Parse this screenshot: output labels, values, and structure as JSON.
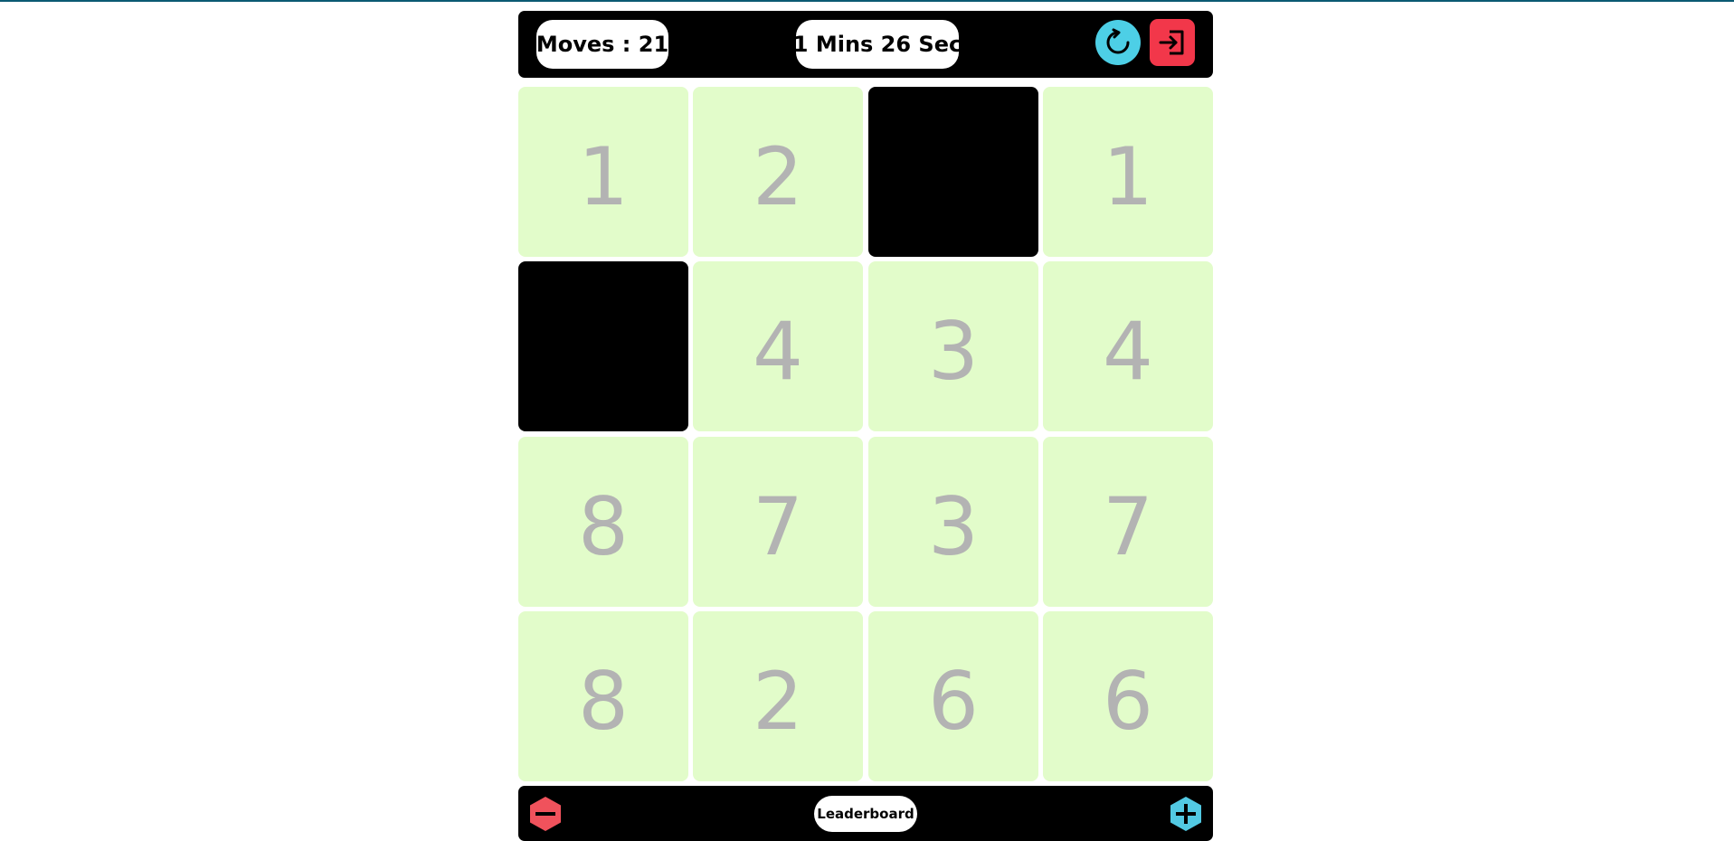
{
  "colors": {
    "top_line": "#0b5a73",
    "bar_bg": "#000000",
    "tile_bg": "#e2fcca",
    "tile_hidden": "#000000",
    "tile_text": "#b3b3b3",
    "restart": "#4dcfe6",
    "exit": "#f2374a",
    "minus": "#f0525c",
    "plus": "#52c9e3"
  },
  "header": {
    "moves_label": "Moves : 21",
    "timer_label": "1 Mins 26 Sec",
    "restart_icon": "restart-icon",
    "exit_icon": "exit-icon"
  },
  "board": {
    "rows": 4,
    "cols": 4,
    "tiles": [
      {
        "value": "1",
        "hidden": false
      },
      {
        "value": "2",
        "hidden": false
      },
      {
        "value": "",
        "hidden": true
      },
      {
        "value": "1",
        "hidden": false
      },
      {
        "value": "",
        "hidden": true
      },
      {
        "value": "4",
        "hidden": false
      },
      {
        "value": "3",
        "hidden": false
      },
      {
        "value": "4",
        "hidden": false
      },
      {
        "value": "8",
        "hidden": false
      },
      {
        "value": "7",
        "hidden": false
      },
      {
        "value": "3",
        "hidden": false
      },
      {
        "value": "7",
        "hidden": false
      },
      {
        "value": "8",
        "hidden": false
      },
      {
        "value": "2",
        "hidden": false
      },
      {
        "value": "6",
        "hidden": false
      },
      {
        "value": "6",
        "hidden": false
      }
    ]
  },
  "footer": {
    "leaderboard_label": "Leaderboard",
    "minus_icon": "minus-hexagon-icon",
    "plus_icon": "plus-hexagon-icon"
  }
}
